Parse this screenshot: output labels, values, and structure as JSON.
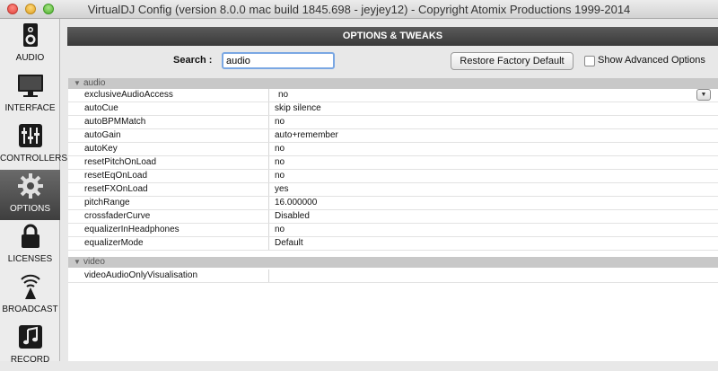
{
  "window": {
    "title": "VirtualDJ Config (version 8.0.0 mac build 1845.698 - jeyjey12) - Copyright Atomix Productions 1999-2014"
  },
  "sidebar": {
    "items": [
      {
        "label": "AUDIO",
        "icon": "speaker-icon"
      },
      {
        "label": "INTERFACE",
        "icon": "monitor-icon"
      },
      {
        "label": "CONTROLLERS",
        "icon": "sliders-icon"
      },
      {
        "label": "OPTIONS",
        "icon": "gear-icon",
        "active": true
      },
      {
        "label": "LICENSES",
        "icon": "lock-icon"
      },
      {
        "label": "BROADCAST",
        "icon": "broadcast-icon"
      },
      {
        "label": "RECORD",
        "icon": "music-note-icon"
      }
    ]
  },
  "main": {
    "header": "OPTIONS & TWEAKS",
    "search_label": "Search :",
    "search_value": "audio",
    "restore_button": "Restore Factory Default",
    "show_advanced_label": "Show Advanced Options",
    "show_advanced_checked": false
  },
  "groups": [
    {
      "name": "audio",
      "rows": [
        {
          "key": "exclusiveAudioAccess",
          "value": "no"
        },
        {
          "key": "autoCue",
          "value": "skip silence"
        },
        {
          "key": "autoBPMMatch",
          "value": "no"
        },
        {
          "key": "autoGain",
          "value": "auto+remember"
        },
        {
          "key": "autoKey",
          "value": "no"
        },
        {
          "key": "resetPitchOnLoad",
          "value": "no"
        },
        {
          "key": "resetEqOnLoad",
          "value": "no"
        },
        {
          "key": "resetFXOnLoad",
          "value": "yes"
        },
        {
          "key": "pitchRange",
          "value": "16.000000"
        },
        {
          "key": "crossfaderCurve",
          "value": "Disabled"
        },
        {
          "key": "equalizerInHeadphones",
          "value": "no"
        },
        {
          "key": "equalizerMode",
          "value": "Default"
        }
      ]
    },
    {
      "name": "video",
      "rows": [
        {
          "key": "videoAudioOnlyVisualisation",
          "value": ""
        }
      ]
    }
  ],
  "colors": {
    "accent_focus": "#7aa7e3",
    "header_bg": "#4a4a4a",
    "group_bg": "#c8c8c8"
  }
}
